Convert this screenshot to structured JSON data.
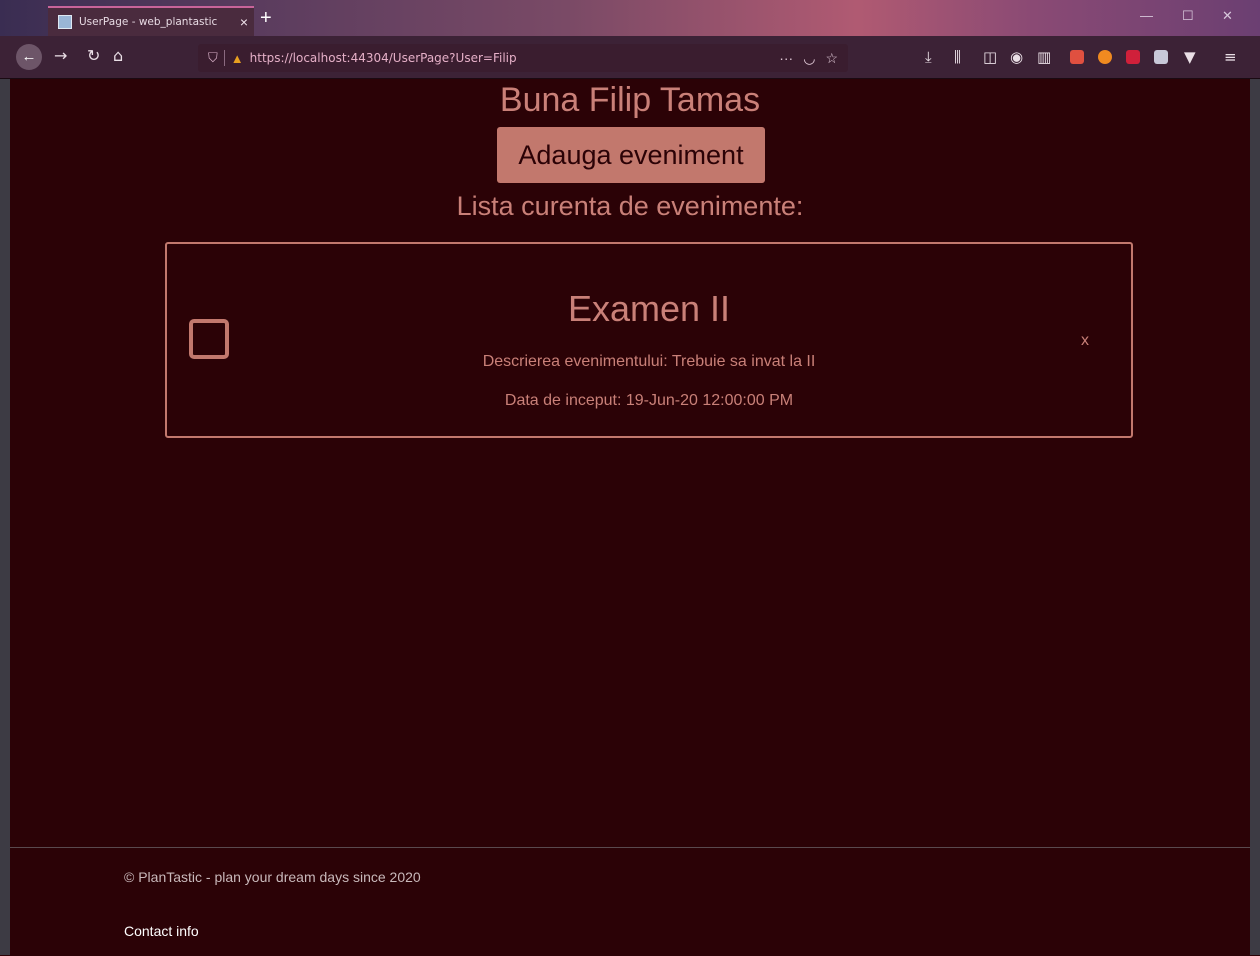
{
  "browser": {
    "tab_title": "UserPage - web_plantastic",
    "tab_close": "×",
    "new_tab": "+",
    "url": "https://localhost:44304/UserPage?User=Filip",
    "page_actions_label": "···",
    "window_minimize": "—",
    "window_maximize": "☐",
    "window_close": "✕",
    "back_icon": "arrow-left-icon",
    "accent": "#c8649a"
  },
  "page": {
    "greeting": "Buna Filip Tamas",
    "add_button_label": "Adauga eveniment",
    "list_heading": "Lista curenta de evenimente:",
    "accent_color": "#c2786d",
    "background_color": "#2b0206"
  },
  "events": [
    {
      "title": "Examen II",
      "description": "Descrierea evenimentului: Trebuie sa invat la II",
      "start_date": "Data de inceput: 19-Jun-20 12:00:00 PM",
      "delete_label": "x",
      "checked": false
    }
  ],
  "footer": {
    "copyright": "© PlanTastic - plan your dream days since 2020",
    "contact": "Contact info"
  }
}
